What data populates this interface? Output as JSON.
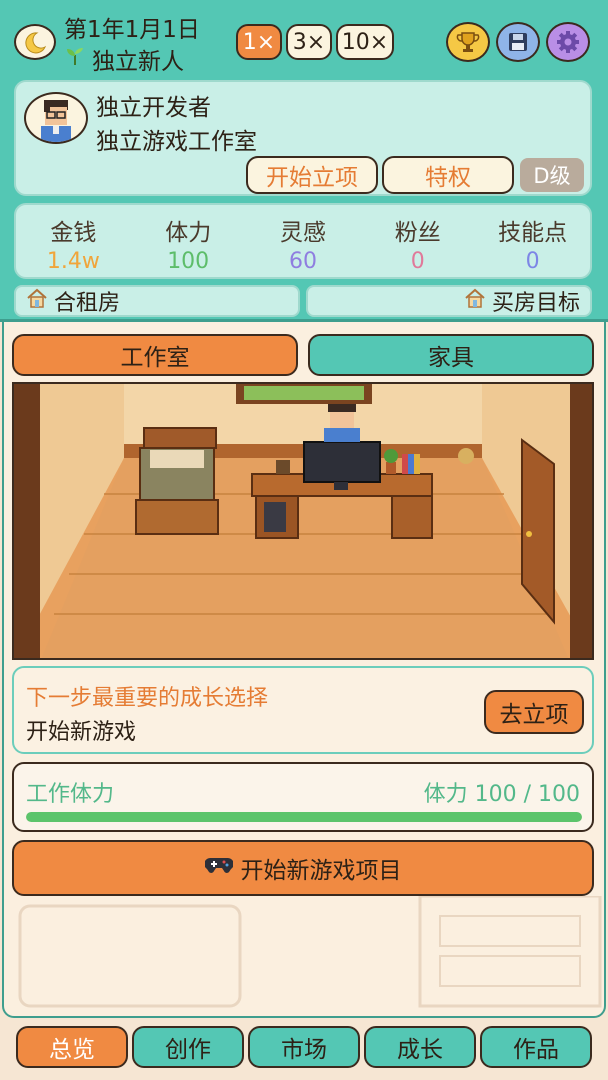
{
  "header": {
    "date": "第1年1月1日",
    "stage_title": "独立新人",
    "speed_options": [
      "1×",
      "3×",
      "10×"
    ],
    "active_speed_index": 0,
    "icons": [
      "moon-icon",
      "trophy-icon",
      "save-icon",
      "gear-icon"
    ]
  },
  "profile": {
    "name": "独立开发者",
    "studio": "独立游戏工作室",
    "start_project_label": "开始立项",
    "privilege_label": "特权",
    "grade": "D级"
  },
  "stats": [
    {
      "label": "金钱",
      "value": "1.4w",
      "color": "#f0a53b"
    },
    {
      "label": "体力",
      "value": "100",
      "color": "#5dbd6a"
    },
    {
      "label": "灵感",
      "value": "60",
      "color": "#8f7ee0"
    },
    {
      "label": "粉丝",
      "value": "0",
      "color": "#e07a9a"
    },
    {
      "label": "技能点",
      "value": "0",
      "color": "#7d86e6"
    }
  ],
  "housing": {
    "current": "合租房",
    "goal": "买房目标"
  },
  "main_tabs": {
    "studio": "工作室",
    "furniture": "家具",
    "active": "studio"
  },
  "next_step": {
    "title": "下一步最重要的成长选择",
    "value": "开始新游戏",
    "button": "去立项"
  },
  "stamina": {
    "label": "工作体力",
    "value_text": "体力 100 / 100",
    "current": 100,
    "max": 100
  },
  "start_button": "开始新游戏项目",
  "nav": {
    "tabs": [
      "总览",
      "创作",
      "市场",
      "成长",
      "作品"
    ],
    "active_index": 0
  },
  "colors": {
    "teal": "#54c7b4",
    "orange": "#f08a42",
    "cream": "#fbf4df"
  }
}
